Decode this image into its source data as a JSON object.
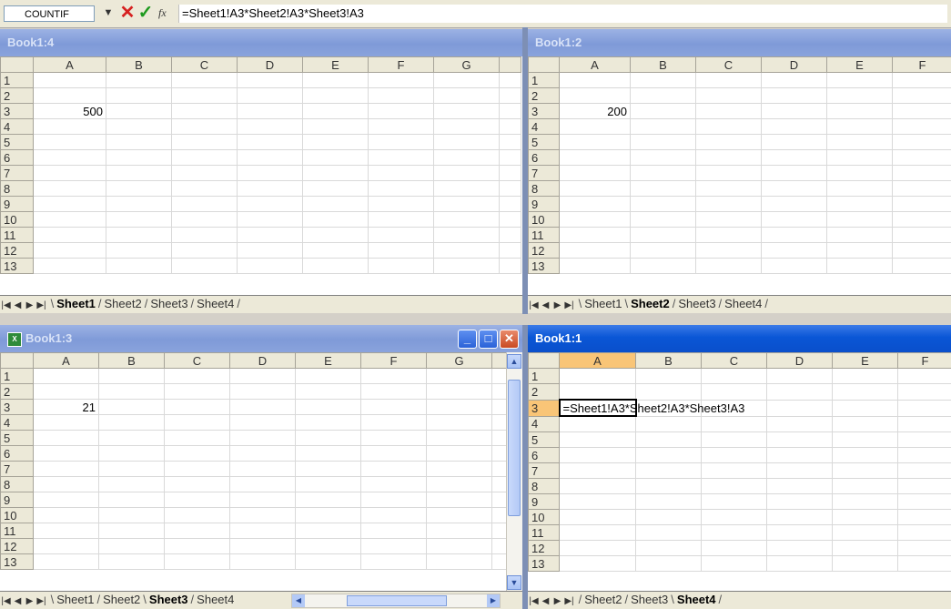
{
  "formula_bar": {
    "name_box": "COUNTIF",
    "dropdown_glyph": "▼",
    "cancel_glyph": "✕",
    "enter_glyph": "✓",
    "fx_label": "fx",
    "formula": "=Sheet1!A3*Sheet2!A3*Sheet3!A3"
  },
  "columns_abc": [
    "A",
    "B",
    "C",
    "D",
    "E",
    "F",
    "G"
  ],
  "rows": [
    "1",
    "2",
    "3",
    "4",
    "5",
    "6",
    "7",
    "8",
    "9",
    "10",
    "11",
    "12",
    "13"
  ],
  "windows": {
    "book4": {
      "title": "Book1:4",
      "a3": "500",
      "tabs": [
        "Sheet1",
        "Sheet2",
        "Sheet3",
        "Sheet4"
      ],
      "active_tab": "Sheet1"
    },
    "book2": {
      "title": "Book1:2",
      "a3": "200",
      "tabs": [
        "Sheet1",
        "Sheet2",
        "Sheet3",
        "Sheet4"
      ],
      "active_tab": "Sheet2"
    },
    "book3": {
      "title": "Book1:3",
      "a3": "21",
      "tabs": [
        "Sheet1",
        "Sheet2",
        "Sheet3",
        "Sheet4"
      ],
      "active_tab": "Sheet3",
      "controls": {
        "minimize": "_",
        "maximize": "□",
        "close": "✕"
      }
    },
    "book1": {
      "title": "Book1:1",
      "a3_editing": "=Sheet1!A3*Sheet2!A3*Sheet3!A3",
      "tabs": [
        "Sheet2",
        "Sheet3",
        "Sheet4"
      ],
      "active_tab": "Sheet4"
    }
  },
  "tab_nav": [
    "|◀",
    "◀",
    "▶",
    "▶|"
  ],
  "colors": {
    "active_title": "#0a56d6",
    "inactive_title": "#8aa3dc",
    "selected_header": "#f9c577"
  }
}
